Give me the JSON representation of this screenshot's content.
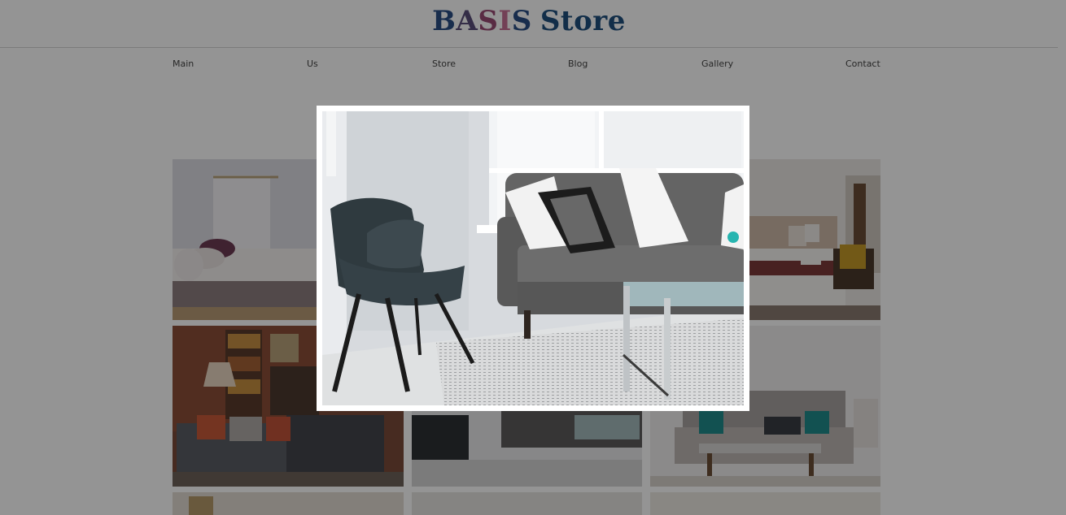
{
  "header": {
    "logo_parts": [
      "B",
      "A",
      "S",
      "I",
      "S"
    ],
    "logo_store": "Store"
  },
  "nav": {
    "items": [
      "Main",
      "Us",
      "Store",
      "Blog",
      "Gallery",
      "Contact"
    ]
  },
  "gallery": {
    "tiles": [
      {
        "subject": "bedroom with white bed"
      },
      {
        "subject": "living room"
      },
      {
        "subject": "bedroom with yellow chair"
      },
      {
        "subject": "brick wall lounge with sofa"
      },
      {
        "subject": "grey sofa with chair and glass table"
      },
      {
        "subject": "grey tufted sofa with teal pillows"
      },
      {
        "subject": "room"
      },
      {
        "subject": "room"
      },
      {
        "subject": "room"
      }
    ]
  },
  "lightbox": {
    "open": true,
    "subject": "grey sofa with black chair and glass table"
  },
  "colors": {
    "logo_blue": "#2a4f86",
    "logo_pink": "#c76f95",
    "overlay": "rgba(0,0,0,0.42)"
  }
}
